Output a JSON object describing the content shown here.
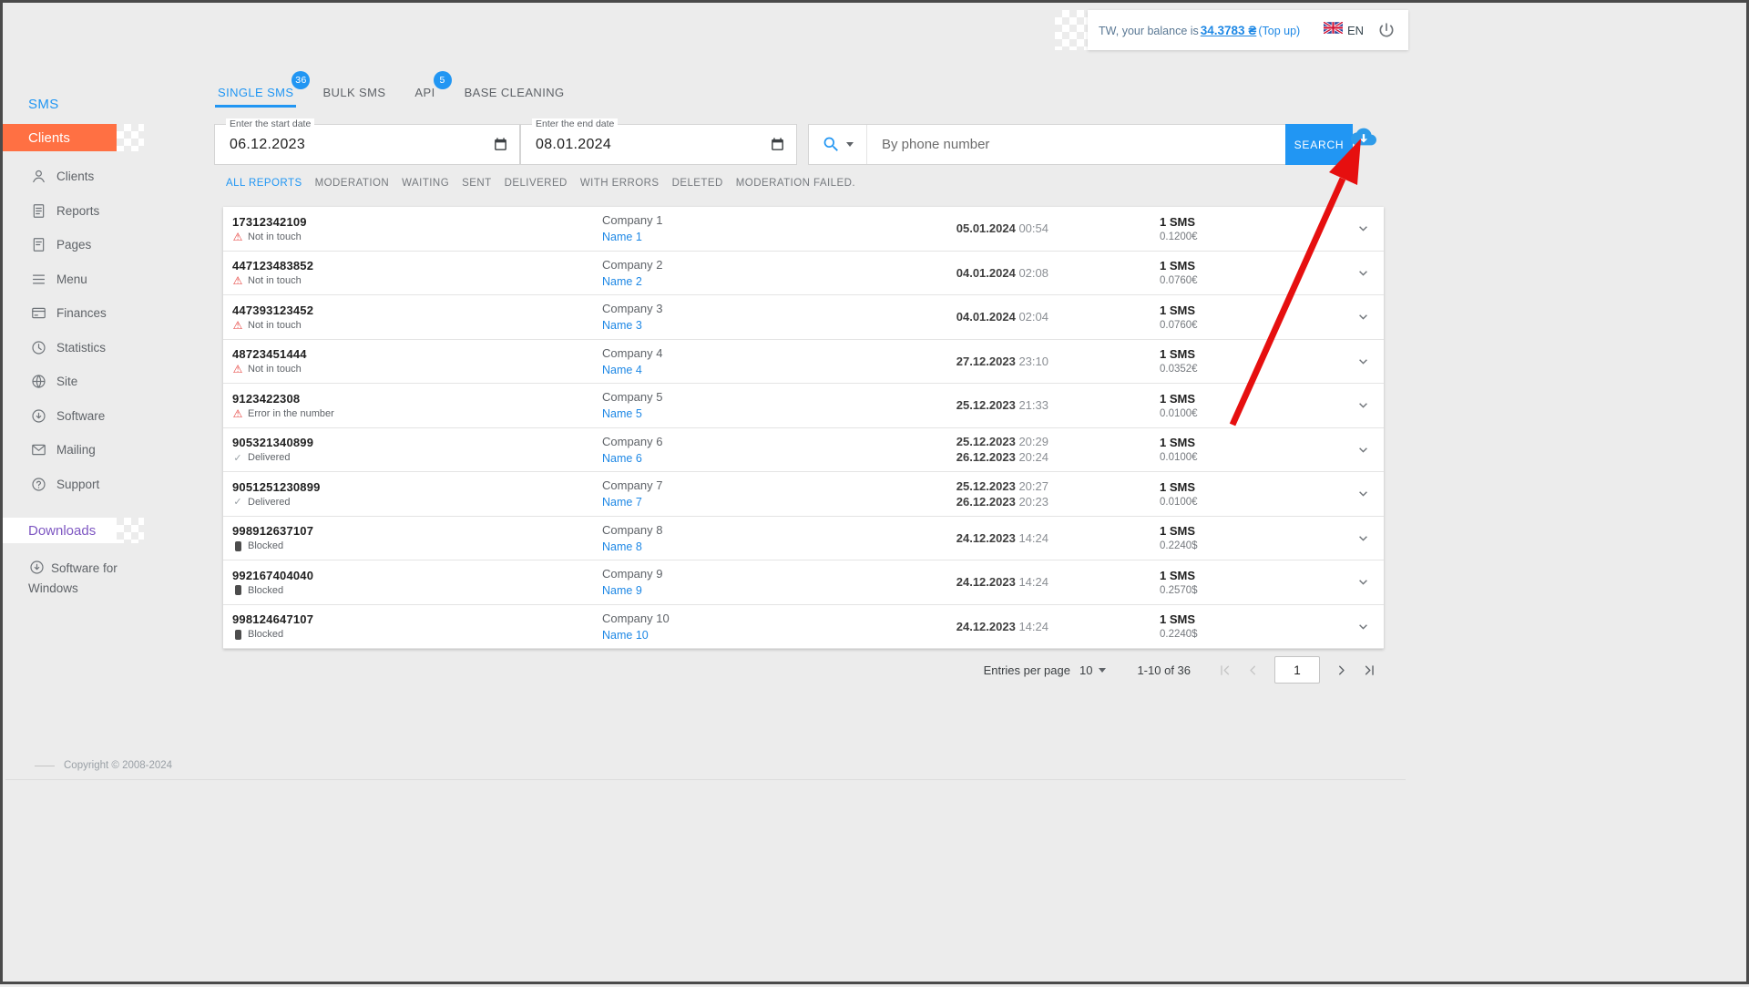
{
  "colors": {
    "accent_blue": "#2196f3",
    "accent_orange": "#ff7043",
    "accent_purple": "#7e57c2",
    "arrow_red": "#e60f0f",
    "warning_red": "#e53935"
  },
  "icons": {
    "status_warning": "⚠",
    "status_delivered": "✓",
    "status_blocked": "dark-rounded-rect",
    "search": "magnifier",
    "export": "cloud-download",
    "logout": "power"
  },
  "header": {
    "balance_prefix": "TW, your balance is",
    "balance_amount": "34.3783 ₴",
    "topup_label": "(Top up)",
    "language": "EN"
  },
  "sidebar": {
    "section_sms": "SMS",
    "section_clients": "Clients",
    "items": [
      {
        "label": "Clients",
        "icon": "clients-icon"
      },
      {
        "label": "Reports",
        "icon": "reports-icon"
      },
      {
        "label": "Pages",
        "icon": "pages-icon"
      },
      {
        "label": "Menu",
        "icon": "menu-icon"
      },
      {
        "label": "Finances",
        "icon": "finances-icon"
      },
      {
        "label": "Statistics",
        "icon": "statistics-icon"
      },
      {
        "label": "Site",
        "icon": "site-icon"
      },
      {
        "label": "Software",
        "icon": "software-icon"
      },
      {
        "label": "Mailing",
        "icon": "mailing-icon"
      },
      {
        "label": "Support",
        "icon": "support-icon"
      }
    ],
    "section_downloads": "Downloads",
    "software_for_windows": "Software for Windows",
    "copyright": "Copyright © 2008-2024"
  },
  "tabs": [
    {
      "label": "SINGLE SMS",
      "badge": "36",
      "active": true
    },
    {
      "label": "BULK SMS",
      "badge": null,
      "active": false
    },
    {
      "label": "API",
      "badge": "5",
      "active": false
    },
    {
      "label": "BASE CLEANING",
      "badge": null,
      "active": false
    }
  ],
  "filters": {
    "start_date_label": "Enter the start date",
    "start_date_value": "06.12.2023",
    "end_date_label": "Enter the end date",
    "end_date_value": "08.01.2024",
    "search_placeholder": "By phone number",
    "search_button_label": "SEARCH"
  },
  "report_tabs": [
    {
      "label": "ALL REPORTS",
      "active": true
    },
    {
      "label": "MODERATION",
      "active": false
    },
    {
      "label": "WAITING",
      "active": false
    },
    {
      "label": "SENT",
      "active": false
    },
    {
      "label": "DELIVERED",
      "active": false
    },
    {
      "label": "WITH ERRORS",
      "active": false
    },
    {
      "label": "DELETED",
      "active": false
    },
    {
      "label": "MODERATION FAILED.",
      "active": false
    }
  ],
  "rows": [
    {
      "phone": "17312342109",
      "status": "Not in touch",
      "status_type": "warning",
      "company": "Company 1",
      "name": "Name 1",
      "dates": [
        {
          "date": "05.01.2024",
          "time": "00:54"
        }
      ],
      "sms": "1 SMS",
      "price": "0.1200€"
    },
    {
      "phone": "447123483852",
      "status": "Not in touch",
      "status_type": "warning",
      "company": "Company 2",
      "name": "Name 2",
      "dates": [
        {
          "date": "04.01.2024",
          "time": "02:08"
        }
      ],
      "sms": "1 SMS",
      "price": "0.0760€"
    },
    {
      "phone": "447393123452",
      "status": "Not in touch",
      "status_type": "warning",
      "company": "Company 3",
      "name": "Name 3",
      "dates": [
        {
          "date": "04.01.2024",
          "time": "02:04"
        }
      ],
      "sms": "1 SMS",
      "price": "0.0760€"
    },
    {
      "phone": "48723451444",
      "status": "Not in touch",
      "status_type": "warning",
      "company": "Company 4",
      "name": "Name 4",
      "dates": [
        {
          "date": "27.12.2023",
          "time": "23:10"
        }
      ],
      "sms": "1 SMS",
      "price": "0.0352€"
    },
    {
      "phone": "9123422308",
      "status": "Error in the number",
      "status_type": "warning",
      "company": "Company 5",
      "name": "Name 5",
      "dates": [
        {
          "date": "25.12.2023",
          "time": "21:33"
        }
      ],
      "sms": "1 SMS",
      "price": "0.0100€"
    },
    {
      "phone": "905321340899",
      "status": "Delivered",
      "status_type": "delivered",
      "company": "Company 6",
      "name": "Name 6",
      "dates": [
        {
          "date": "25.12.2023",
          "time": "20:29"
        },
        {
          "date": "26.12.2023",
          "time": "20:24"
        }
      ],
      "sms": "1 SMS",
      "price": "0.0100€"
    },
    {
      "phone": "9051251230899",
      "status": "Delivered",
      "status_type": "delivered",
      "company": "Company 7",
      "name": "Name 7",
      "dates": [
        {
          "date": "25.12.2023",
          "time": "20:27"
        },
        {
          "date": "26.12.2023",
          "time": "20:23"
        }
      ],
      "sms": "1 SMS",
      "price": "0.0100€"
    },
    {
      "phone": "998912637107",
      "status": "Blocked",
      "status_type": "blocked",
      "company": "Company 8",
      "name": "Name 8",
      "dates": [
        {
          "date": "24.12.2023",
          "time": "14:24"
        }
      ],
      "sms": "1 SMS",
      "price": "0.2240$"
    },
    {
      "phone": "992167404040",
      "status": "Blocked",
      "status_type": "blocked",
      "company": "Company 9",
      "name": "Name 9",
      "dates": [
        {
          "date": "24.12.2023",
          "time": "14:24"
        }
      ],
      "sms": "1 SMS",
      "price": "0.2570$"
    },
    {
      "phone": "998124647107",
      "status": "Blocked",
      "status_type": "blocked",
      "company": "Company 10",
      "name": "Name 10",
      "dates": [
        {
          "date": "24.12.2023",
          "time": "14:24"
        }
      ],
      "sms": "1 SMS",
      "price": "0.2240$"
    }
  ],
  "pagination": {
    "entries_per_page_label": "Entries per page",
    "entries_per_page_value": "10",
    "range_label": "1-10 of 36",
    "page_value": "1"
  }
}
